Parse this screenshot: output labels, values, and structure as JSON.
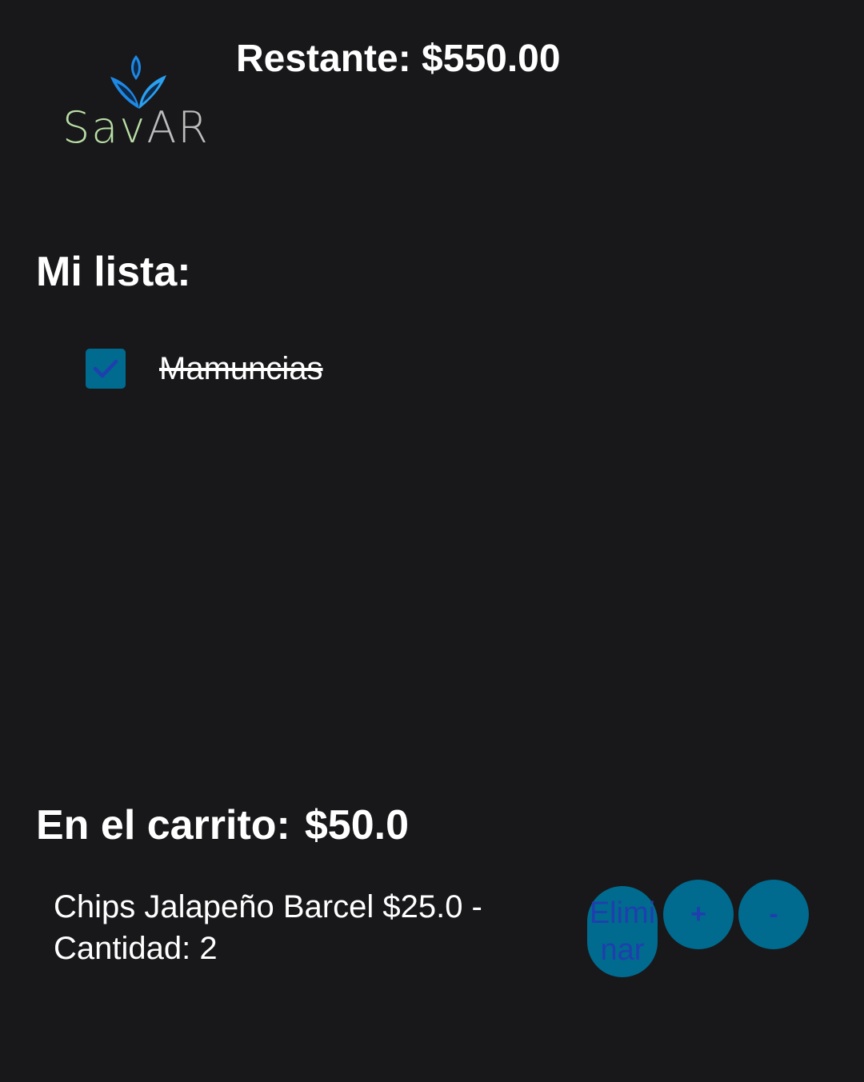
{
  "header": {
    "logo": {
      "brand_part1": "Sav",
      "brand_part2": "AR",
      "icon": "leaf-logo-icon"
    },
    "remaining_label": "Restante: $550.00"
  },
  "list": {
    "heading": "Mi lista:",
    "items": [
      {
        "label": "Mamuncias",
        "checked": true
      }
    ]
  },
  "cart": {
    "heading": "En el carrito:",
    "total": "$50.0",
    "rows": [
      {
        "text": "Chips Jalapeño Barcel $25.0 - Cantidad: 2",
        "delete_label": "Eliminar",
        "plus_label": "+",
        "minus_label": "-"
      }
    ]
  },
  "colors": {
    "background": "#18181b",
    "accent": "#006b8f",
    "button_text": "#1f3fae",
    "logo_green": "#b9dfa5",
    "logo_gray": "#bdbdbd"
  }
}
